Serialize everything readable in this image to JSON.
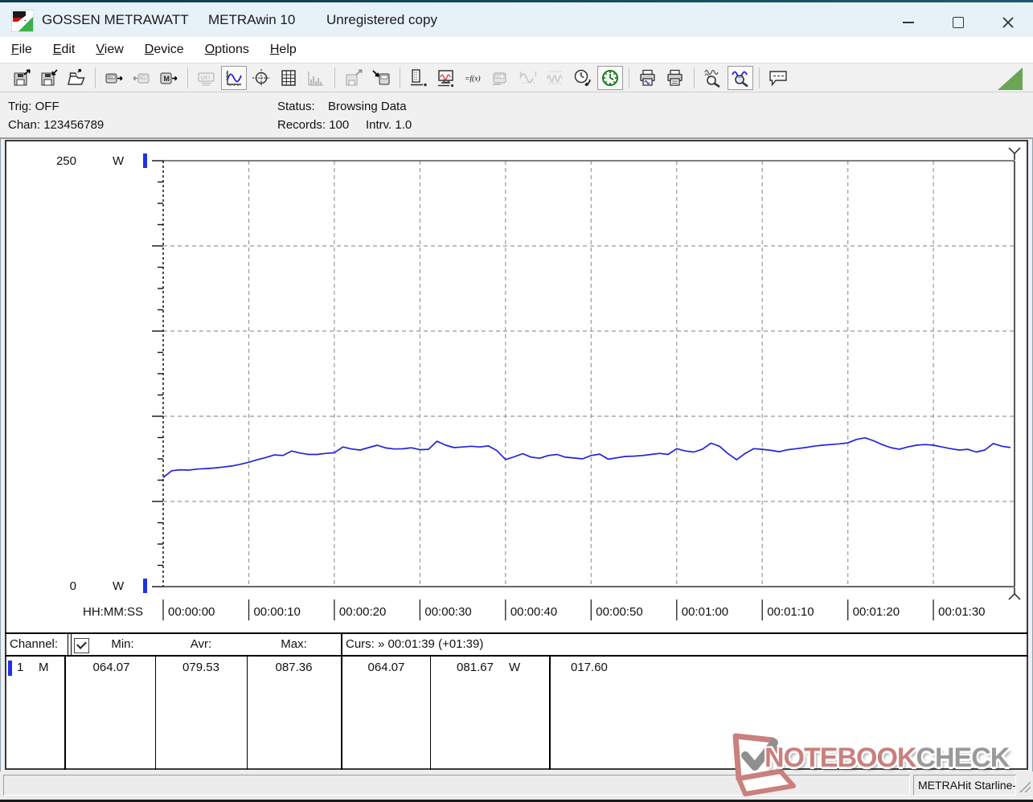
{
  "titlebar": {
    "app_name": "GOSSEN METRAWATT",
    "product": "METRAwin 10",
    "license": "Unregistered copy"
  },
  "menu": {
    "items": [
      "File",
      "Edit",
      "View",
      "Device",
      "Options",
      "Help"
    ]
  },
  "toolbar": {
    "buttons": [
      {
        "name": "save-file-button",
        "icon": "floppy-out",
        "state": "normal",
        "sep_after": false
      },
      {
        "name": "save-as-button",
        "icon": "floppy-in",
        "state": "normal",
        "sep_after": false
      },
      {
        "name": "open-file-button",
        "icon": "folder-open",
        "state": "normal",
        "sep_after": true
      },
      {
        "name": "read-device-button",
        "icon": "meter-out",
        "state": "normal",
        "sep_after": false
      },
      {
        "name": "write-device-button",
        "icon": "meter-in",
        "state": "disabled",
        "sep_after": false
      },
      {
        "name": "read-memory-button",
        "icon": "memory-out",
        "state": "normal",
        "sep_after": true
      },
      {
        "name": "numeric-display-button",
        "icon": "display-1257",
        "state": "disabled",
        "sep_after": false
      },
      {
        "name": "curve-view-button",
        "icon": "curve",
        "state": "pressed",
        "sep_after": false
      },
      {
        "name": "xy-view-button",
        "icon": "crosshair",
        "state": "normal",
        "sep_after": false
      },
      {
        "name": "table-view-button",
        "icon": "table-grid",
        "state": "normal",
        "sep_after": false
      },
      {
        "name": "histogram-view-button",
        "icon": "histogram",
        "state": "disabled",
        "sep_after": true
      },
      {
        "name": "export-button",
        "icon": "floppy-export",
        "state": "disabled",
        "sep_after": false
      },
      {
        "name": "transfer-button",
        "icon": "transfer-in",
        "state": "normal",
        "sep_after": true
      },
      {
        "name": "sequence-button",
        "icon": "sequence-probe",
        "state": "normal",
        "sep_after": false
      },
      {
        "name": "monitor-button",
        "icon": "monitor-wave",
        "state": "normal",
        "sep_after": false
      },
      {
        "name": "formula-button",
        "icon": "formula",
        "state": "normal",
        "sep_after": false
      },
      {
        "name": "meter-display-button",
        "icon": "meter-321",
        "state": "disabled",
        "sep_after": false
      },
      {
        "name": "single-curve-button",
        "icon": "sine-single",
        "state": "disabled",
        "sep_after": false
      },
      {
        "name": "multi-curve-button",
        "icon": "sine-multi",
        "state": "disabled",
        "sep_after": false
      },
      {
        "name": "time-mode-button",
        "icon": "clock-12",
        "state": "normal",
        "sep_after": false
      },
      {
        "name": "timer-button",
        "icon": "clock-green",
        "state": "pressed",
        "sep_after": true
      },
      {
        "name": "print-graph-button",
        "icon": "printer-wave",
        "state": "normal",
        "sep_after": false
      },
      {
        "name": "print-button",
        "icon": "printer",
        "state": "normal",
        "sep_after": true
      },
      {
        "name": "zoom-all-button",
        "icon": "zoom-waves",
        "state": "normal",
        "sep_after": false
      },
      {
        "name": "zoom-curve-button",
        "icon": "zoom-wave-blue",
        "state": "pressed",
        "sep_after": true
      },
      {
        "name": "annotation-button",
        "icon": "callout",
        "state": "normal",
        "sep_after": false
      }
    ]
  },
  "status_panel": {
    "trig": "Trig: OFF",
    "chan": "Chan: 123456789",
    "status_label": "Status:",
    "status_value": "Browsing Data",
    "records": "Records: 100",
    "interval": "Intrv. 1.0"
  },
  "chart_data": {
    "type": "line",
    "title": "",
    "xlabel": "HH:MM:SS",
    "ylabel": "W",
    "unit": "W",
    "ylim": [
      0,
      250
    ],
    "y_max_label": "250",
    "y_min_label": "0",
    "grid": true,
    "legend": "none",
    "x_interval_seconds": 1.0,
    "x_ticks": [
      "00:00:00",
      "00:00:10",
      "00:00:20",
      "00:00:30",
      "00:00:40",
      "00:00:50",
      "00:01:00",
      "00:01:10",
      "00:01:20",
      "00:01:30"
    ],
    "cursor_position": "00:01:39",
    "series": [
      {
        "name": "Channel 1",
        "color": "#2222dd",
        "values": [
          64.07,
          68.0,
          68.6,
          68.4,
          69.0,
          69.3,
          69.6,
          70.2,
          70.8,
          71.8,
          73.0,
          74.5,
          75.8,
          77.3,
          77.0,
          79.6,
          78.4,
          77.6,
          77.6,
          78.2,
          78.6,
          82.0,
          80.8,
          80.2,
          81.6,
          83.0,
          81.4,
          80.8,
          80.9,
          81.5,
          80.4,
          80.6,
          85.4,
          83.0,
          81.6,
          82.0,
          82.4,
          82.0,
          82.6,
          79.8,
          74.6,
          76.2,
          78.0,
          76.0,
          75.4,
          77.0,
          77.6,
          76.0,
          75.5,
          75.0,
          77.0,
          77.8,
          74.8,
          75.6,
          76.4,
          76.6,
          77.0,
          77.6,
          78.2,
          77.6,
          81.0,
          79.6,
          79.0,
          80.6,
          84.2,
          82.4,
          78.0,
          74.5,
          78.2,
          81.0,
          80.6,
          80.0,
          79.2,
          80.4,
          81.0,
          81.6,
          82.4,
          83.0,
          83.4,
          83.8,
          84.4,
          86.4,
          87.36,
          85.6,
          83.4,
          81.6,
          80.6,
          82.0,
          83.0,
          83.4,
          83.0,
          82.0,
          81.0,
          80.2,
          80.6,
          79.0,
          80.2,
          84.0,
          82.4,
          81.67
        ]
      }
    ]
  },
  "table": {
    "header": {
      "channel": "Channel:",
      "checkbox_checked": true,
      "min": "Min:",
      "avr": "Avr:",
      "max": "Max:",
      "cursor": "Curs: » 00:01:39 (+01:39)"
    },
    "row": {
      "channel": "1",
      "mode": "M",
      "min": "064.07",
      "avr": "079.53",
      "max": "087.36",
      "cursor_a": "064.07",
      "cursor_b": "081.67",
      "unit": "W",
      "delta": "017.60"
    }
  },
  "watermark": {
    "part1": "NOTEBOOK",
    "part2": "CHECK"
  },
  "statusbar": {
    "device": "METRAHit Starline-Seri"
  },
  "colors": {
    "accent_line": "#2222dd",
    "channel_marker": "#2130e8",
    "grip_green": "#6ba455",
    "watermark_red": "#c9807e",
    "watermark_gray": "#9a9a9a"
  }
}
